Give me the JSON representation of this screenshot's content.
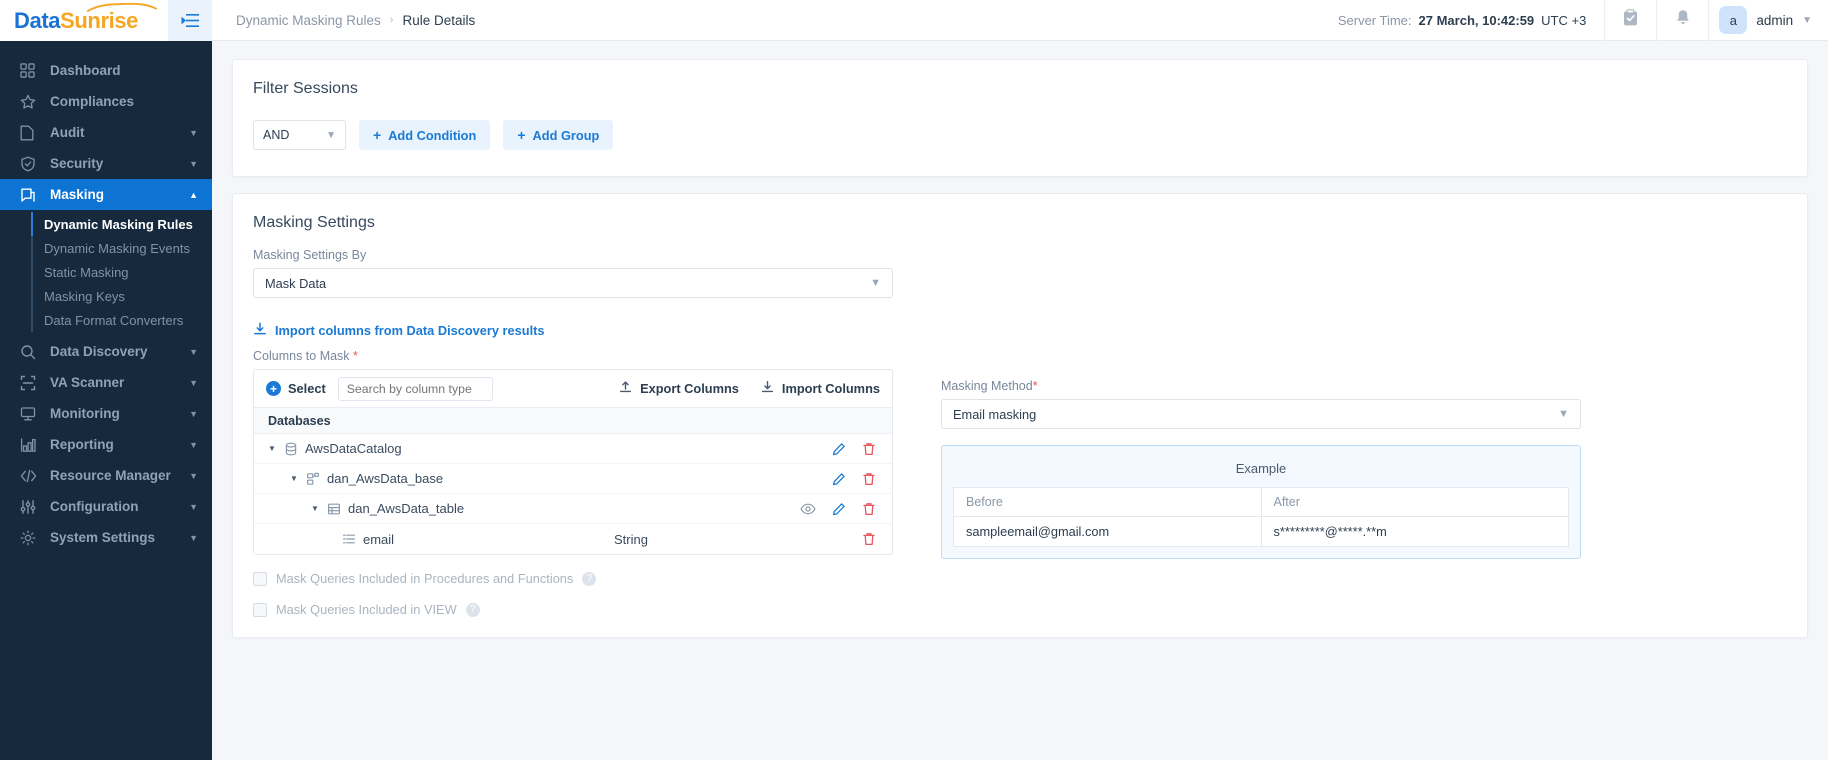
{
  "brand": {
    "name_part1": "Data",
    "name_part2": "Sunrise"
  },
  "sidebar": {
    "items": [
      {
        "label": "Dashboard",
        "icon": "grid-icon",
        "expandable": false
      },
      {
        "label": "Compliances",
        "icon": "star-icon",
        "expandable": false
      },
      {
        "label": "Audit",
        "icon": "file-icon",
        "expandable": true
      },
      {
        "label": "Security",
        "icon": "shield-icon",
        "expandable": true
      },
      {
        "label": "Masking",
        "icon": "mask-icon",
        "expandable": true,
        "active": true
      },
      {
        "label": "Data Discovery",
        "icon": "search-icon",
        "expandable": true
      },
      {
        "label": "VA Scanner",
        "icon": "scan-icon",
        "expandable": true
      },
      {
        "label": "Monitoring",
        "icon": "monitor-icon",
        "expandable": true
      },
      {
        "label": "Reporting",
        "icon": "bar-chart-icon",
        "expandable": true
      },
      {
        "label": "Resource Manager",
        "icon": "code-icon",
        "expandable": true
      },
      {
        "label": "Configuration",
        "icon": "sliders-icon",
        "expandable": true
      },
      {
        "label": "System Settings",
        "icon": "gear-icon",
        "expandable": true
      }
    ],
    "masking_subitems": [
      {
        "label": "Dynamic Masking Rules",
        "selected": true
      },
      {
        "label": "Dynamic Masking Events",
        "selected": false
      },
      {
        "label": "Static Masking",
        "selected": false
      },
      {
        "label": "Masking Keys",
        "selected": false
      },
      {
        "label": "Data Format Converters",
        "selected": false
      }
    ]
  },
  "header": {
    "breadcrumb_parent": "Dynamic Masking Rules",
    "breadcrumb_sep": "›",
    "breadcrumb_current": "Rule Details",
    "server_time_label": "Server Time:",
    "server_time_value": "27 March, 10:42:59",
    "server_time_tz": "UTC +3",
    "user_initial": "a",
    "user_name": "admin"
  },
  "filter_sessions": {
    "title": "Filter Sessions",
    "operator": "AND",
    "add_condition": "Add Condition",
    "add_group": "Add Group"
  },
  "masking_settings": {
    "title": "Masking Settings",
    "settings_by_label": "Masking Settings By",
    "settings_by_value": "Mask Data",
    "import_link": "Import columns from Data Discovery results",
    "columns_to_mask_label": "Columns to Mask",
    "select_label": "Select",
    "search_placeholder": "Search by column type",
    "export_columns": "Export Columns",
    "import_columns": "Import Columns",
    "table_header": "Databases",
    "tree": [
      {
        "label": "AwsDataCatalog",
        "level": 0,
        "icon": "database-icon",
        "expanded": true,
        "type": "",
        "actions": [
          "edit",
          "delete"
        ]
      },
      {
        "label": "dan_AwsData_base",
        "level": 1,
        "icon": "schema-icon",
        "expanded": true,
        "type": "",
        "actions": [
          "edit",
          "delete"
        ]
      },
      {
        "label": "dan_AwsData_table",
        "level": 2,
        "icon": "table-icon",
        "expanded": true,
        "type": "",
        "actions": [
          "eye",
          "edit",
          "delete"
        ]
      },
      {
        "label": "email",
        "level": 3,
        "icon": "column-icon",
        "expanded": false,
        "type": "String",
        "actions": [
          "delete"
        ]
      }
    ],
    "masking_method_label": "Masking Method",
    "masking_method_value": "Email masking",
    "example_title": "Example",
    "example_col_before": "Before",
    "example_col_after": "After",
    "example_before_value": "sampleemail@gmail.com",
    "example_after_value": "s*********@*****.**m",
    "checkbox_procedures": "Mask Queries Included in Procedures and Functions",
    "checkbox_view": "Mask Queries Included in VIEW",
    "help_glyph": "?"
  },
  "colors": {
    "sidebar_bg": "#17293c",
    "accent_blue": "#1a7ad4",
    "active_nav": "#0d74d4",
    "danger": "#e8565b",
    "brand_orange": "#f5a623"
  }
}
